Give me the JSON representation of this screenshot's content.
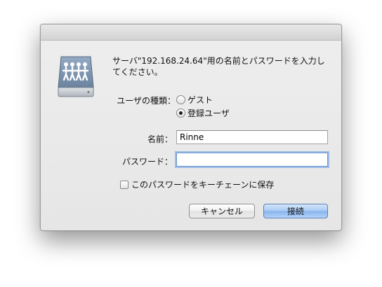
{
  "dialog": {
    "prompt": "サーバ\"192.168.24.64\"用の名前とパスワードを入力してください。",
    "icon": "shared-server-icon",
    "user_type": {
      "label": "ユーザの種類：",
      "options": [
        {
          "label": "ゲスト",
          "selected": false
        },
        {
          "label": "登録ユーザ",
          "selected": true
        }
      ]
    },
    "name_field": {
      "label": "名前：",
      "value": "Rinne"
    },
    "password_field": {
      "label": "パスワード：",
      "value": ""
    },
    "remember_checkbox": {
      "label": "このパスワードをキーチェーンに保存",
      "checked": false
    },
    "buttons": {
      "cancel": "キャンセル",
      "connect": "接続"
    },
    "colors": {
      "default_button": "#87b3ec",
      "focus_ring": "#9dbde7",
      "icon_body": "#7f96b2"
    }
  }
}
